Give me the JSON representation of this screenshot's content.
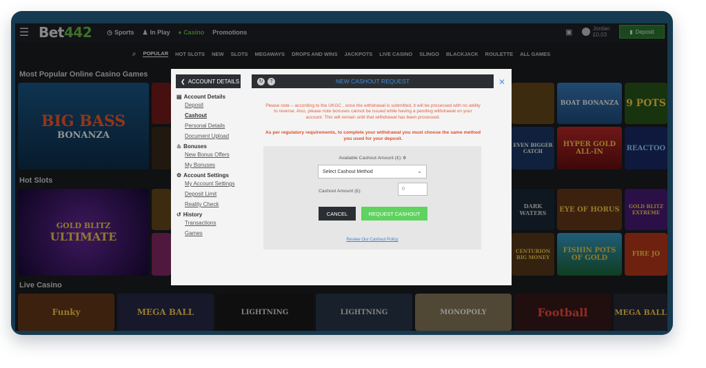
{
  "header": {
    "logo_main": "Bet",
    "logo_accent": "442",
    "nav": [
      {
        "icon": "clock-icon",
        "label": "Sports"
      },
      {
        "icon": "person-icon",
        "label": "In Play"
      },
      {
        "icon": "casino-icon",
        "label": "Casino"
      },
      {
        "icon": "",
        "label": "Promotions"
      }
    ],
    "user_name": "Jordan",
    "user_balance": "£0.03",
    "deposit_label": "Deposit"
  },
  "categories": [
    "POPULAR",
    "HOT SLOTS",
    "NEW",
    "SLOTS",
    "MEGAWAYS",
    "DROPS AND WINS",
    "JACKPOTS",
    "LIVE CASINO",
    "SLINGO",
    "BLACKJACK",
    "ROULETTE",
    "ALL GAMES"
  ],
  "sections": {
    "popular": "Most Popular Online Casino Games",
    "hot": "Hot Slots",
    "live": "Live Casino"
  },
  "tiles": {
    "big_bass": "BIG BASS",
    "big_bass_sub": "BONANZA",
    "gold_blitz": "GOLD BLITZ",
    "gold_blitz_sub": "ULTIMATE",
    "boat": "BOAT BONANZA",
    "nine_pots": "9 POTS",
    "hyper_gold": "HYPER GOLD ALL-IN",
    "reactoonz": "REACTOO",
    "dark_waters": "DARK WATERS",
    "eye_horus": "EYE OF HORUS",
    "gold_blitz_ext": "GOLD BLITZ EXTREME",
    "centurion": "CENTURION BIG MONEY",
    "fishin": "FISHIN POTS OF GOLD",
    "fire": "FIRE JO",
    "even_bigger": "EVEN BIGGER CATCH",
    "funky": "Funky",
    "mega_ball": "MEGA BALL",
    "lightning": "LIGHTNING",
    "monopoly": "MONOPOLY",
    "football": "Football",
    "mega_ball2": "MEGA BALL"
  },
  "modal": {
    "side_header": "ACCOUNT DETAILS",
    "groups": [
      {
        "icon": "id-card-icon",
        "title": "Account Details",
        "links": [
          "Deposit",
          "Cashout",
          "Personal Details",
          "Document Upload"
        ]
      },
      {
        "icon": "bonus-icon",
        "title": "Bonuses",
        "links": [
          "New Bonus Offers",
          "My Bonuses"
        ]
      },
      {
        "icon": "gear-icon",
        "title": "Account Settings",
        "links": [
          "My Account Settings",
          "Deposit Limit",
          "Reality Check"
        ]
      },
      {
        "icon": "history-icon",
        "title": "History",
        "links": [
          "Transactions",
          "Games"
        ]
      }
    ],
    "active_link": "Cashout",
    "title": "NEW CASHOUT REQUEST",
    "note": "Please note – according to the UKGC , once the withdrawal is submitted, it will be processed with no ability to reverse. Also, please note bonuses cannot be issued while having a pending withdrawal on your account. This will remain until that withdrawal has been processed.",
    "note_bold": "As per regulatory requirements, to complete your withdrawal you must choose the same method you used for your deposit.",
    "available_label": "Available Cashout Amount (£):",
    "available_value": "0",
    "method_placeholder": "Select Cashout Method",
    "amount_label": "Cashout Amount (£):",
    "amount_value": "0",
    "cancel": "CANCEL",
    "request": "REQUEST CASHOUT",
    "policy": "Review Our Cashout Policy"
  },
  "colors": {
    "accent": "#6cc04a",
    "title_blue": "#3f8ee0",
    "warn": "#e55c3c",
    "request_green": "#5fd35f"
  }
}
